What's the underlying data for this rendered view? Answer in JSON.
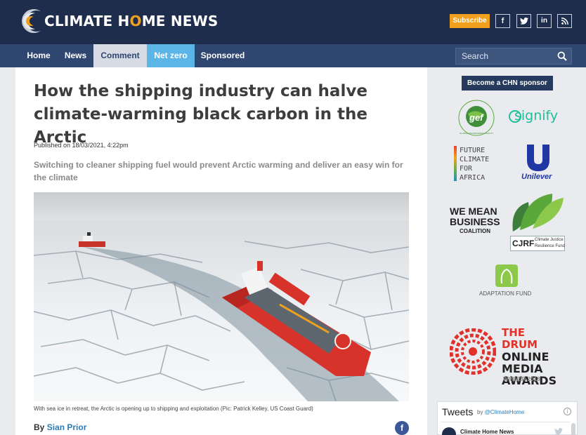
{
  "header": {
    "logo_part1": "CLIMATE H",
    "logo_o": "O",
    "logo_part2": "ME NEWS",
    "subscribe_label": "Subscribe",
    "social": [
      {
        "icon": "facebook-icon",
        "glyph": "f"
      },
      {
        "icon": "twitter-icon",
        "glyph": "t"
      },
      {
        "icon": "linkedin-icon",
        "glyph": "in"
      },
      {
        "icon": "rss-icon",
        "glyph": "rss"
      }
    ]
  },
  "nav": {
    "items": [
      "Home",
      "News",
      "Comment",
      "Net zero",
      "Sponsored"
    ],
    "search_placeholder": "Search"
  },
  "article": {
    "title": "How the shipping industry can halve climate-warming black carbon in the Arctic",
    "published": "Published on 18/03/2021, 4:22pm",
    "standfirst": "Switching to cleaner shipping fuel would prevent Arctic warming and deliver an easy win for the climate",
    "caption": "With sea ice in retreat, the Arctic is opening up to shipping and exploitation (Pic: Patrick Kelley, US Coast Guard)",
    "byline_prefix": "By ",
    "author": "Sian Prior"
  },
  "sidebar": {
    "sponsor_button": "Become a CHN sponsor",
    "gef": "gef",
    "gef_ring": "GLOBAL ENVIRONMENT FACILITY · INVESTING IN OUR PLANET ·",
    "signify": "signify",
    "future_lines": [
      "FUTURE",
      "CLIMATE",
      "FOR",
      "AFRICA"
    ],
    "unilever": "Unilever",
    "wemean_lines": [
      "WE MEAN",
      "BUSINESS",
      "COALITION"
    ],
    "cjrf": "CJRF",
    "cjrf_sub": [
      "Climate Justice",
      "Resilience Fund"
    ],
    "adaptation": "ADAPTATION FUND",
    "drum_lines": [
      "THE DRUM",
      "ONLINE",
      "MEDIA",
      "AWARDS"
    ],
    "drum_winner": "WINNER 2018"
  },
  "tweets": {
    "title": "Tweets",
    "by_prefix": "by ",
    "handle": "@ClimateHome",
    "first_account": "Climate Home News"
  },
  "colors": {
    "header_bg": "#1f2d4d",
    "nav_bg": "#2e4670",
    "accent_orange": "#f0a01c",
    "net_zero_blue": "#5bb5e6",
    "link_blue": "#2e7bb5",
    "ship_red": "#d8332b"
  }
}
